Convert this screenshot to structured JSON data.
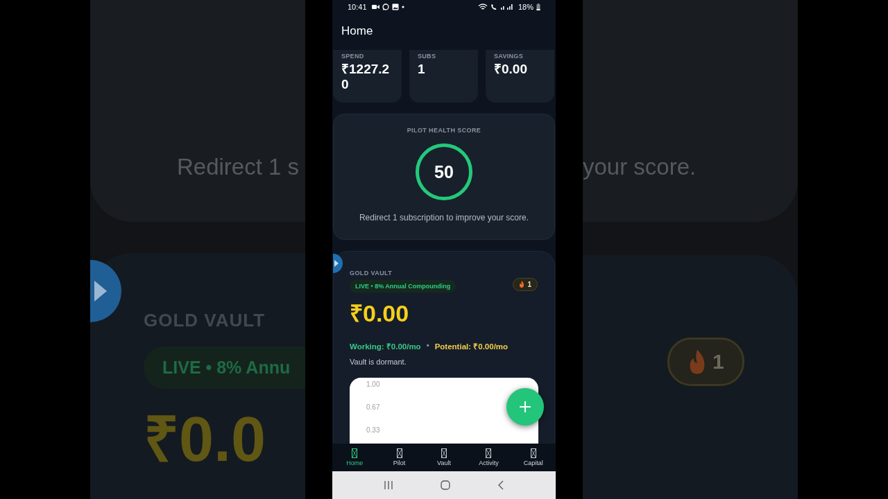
{
  "backdrop": {
    "left": {
      "message": "Redirect 1 s",
      "title": "GOLD VAULT",
      "badge": "LIVE • 8% Annu",
      "amount": "₹0.0"
    },
    "right": {
      "message": "your score.",
      "streak": "1"
    }
  },
  "status_bar": {
    "time": "10:41",
    "battery": "18%"
  },
  "header": {
    "title": "Home"
  },
  "stats": [
    {
      "label": "SPEND",
      "value": "₹1227.20"
    },
    {
      "label": "SUBS",
      "value": "1"
    },
    {
      "label": "SAVINGS",
      "value": "₹0.00"
    }
  ],
  "health": {
    "title": "PILOT HEALTH SCORE",
    "score": "50",
    "message": "Redirect 1 subscription to improve your score."
  },
  "vault": {
    "title": "GOLD VAULT",
    "badge": "LIVE • 8% Annual Compounding",
    "streak": "1",
    "amount": "₹0.00",
    "working": "Working: ₹0.00/mo",
    "separator": "•",
    "potential": "Potential: ₹0.00/mo",
    "status": "Vault is dormant.",
    "chart_axis_labels": [
      "1.00",
      "0.67",
      "0.33"
    ]
  },
  "tabs": [
    {
      "label": "Home",
      "selected": true
    },
    {
      "label": "Pilot",
      "selected": false
    },
    {
      "label": "Vault",
      "selected": false
    },
    {
      "label": "Activity",
      "selected": false
    },
    {
      "label": "Capital",
      "selected": false
    }
  ]
}
